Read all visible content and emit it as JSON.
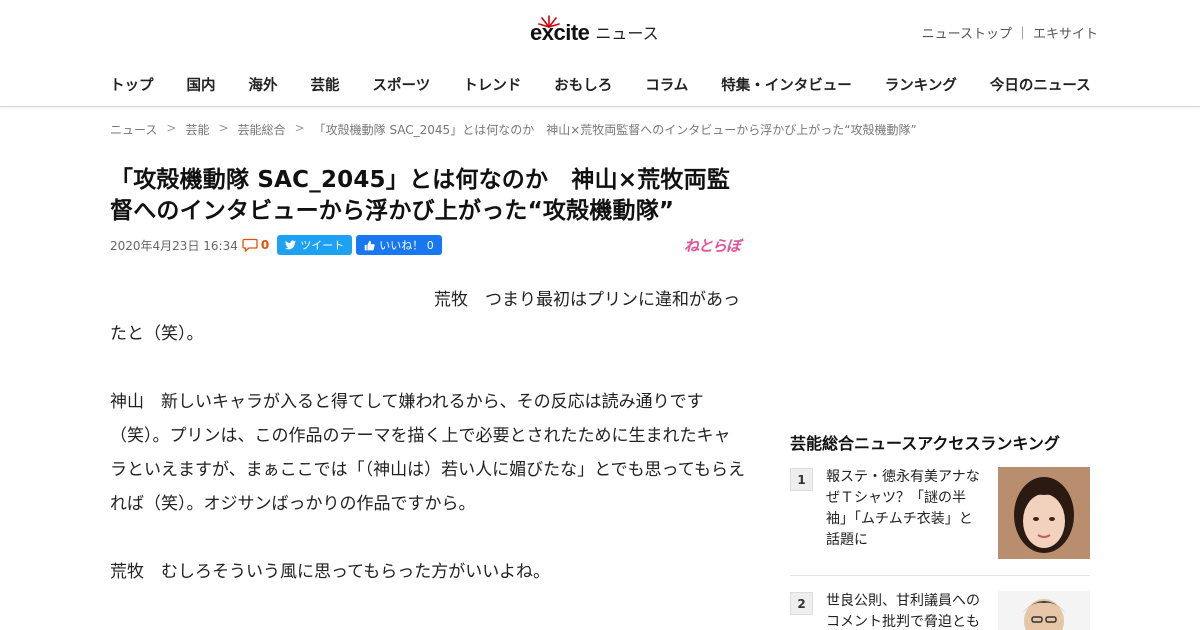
{
  "header": {
    "logo_text": "excite",
    "logo_sub": "ニュース",
    "toplinks": [
      "ニューストップ",
      "｜",
      "エキサイト"
    ]
  },
  "nav": [
    "トップ",
    "国内",
    "海外",
    "芸能",
    "スポーツ",
    "トレンド",
    "おもしろ",
    "コラム",
    "特集・インタビュー",
    "ランキング",
    "今日のニュース"
  ],
  "breadcrumb": [
    "ニュース",
    "芸能",
    "芸能総合",
    "「攻殻機動隊 SAC_2045」とは何なのか　神山×荒牧両監督へのインタビューから浮かび上がった“攻殻機動隊”"
  ],
  "breadcrumb_sep": ">",
  "article": {
    "title": "「攻殻機動隊 SAC_2045」とは何なのか　神山×荒牧両監督へのインタビューから浮かび上がった“攻殻機動隊”",
    "date": "2020年4月23日 16:34",
    "comment_count": "0",
    "tweet_label": "ツイート",
    "like_label": "いいね！ 0",
    "source_logo": "ねとらぼ",
    "paragraphs": [
      "荒牧　つまり最初はプリンに違和があったと（笑）。",
      "神山　新しいキャラが入ると得てして嫌われるから、その反応は読み通りです（笑）。プリンは、この作品のテーマを描く上で必要とされたために生まれたキャラといえますが、まぁここでは「（神山は）若い人に媚びたな」とでも思ってもらえれば（笑）。オジサンばっかりの作品ですから。",
      "荒牧　むしろそういう風に思ってもらった方がいいよね。"
    ]
  },
  "sidebar": {
    "ranking_title": "芸能総合ニュースアクセスランキング",
    "items": [
      {
        "rank": "1",
        "text": "報ステ・徳永有美アナなぜＴシャツ？「謎の半袖」「ムチムチ衣装」と話題に"
      },
      {
        "rank": "2",
        "text": "世良公則、甘利議員へのコメント批判で脅迫とも"
      }
    ]
  },
  "colors": {
    "accent_red": "#d7000f",
    "twitter": "#1da1f2",
    "facebook": "#1877f2",
    "comment_orange": "#e65100"
  }
}
